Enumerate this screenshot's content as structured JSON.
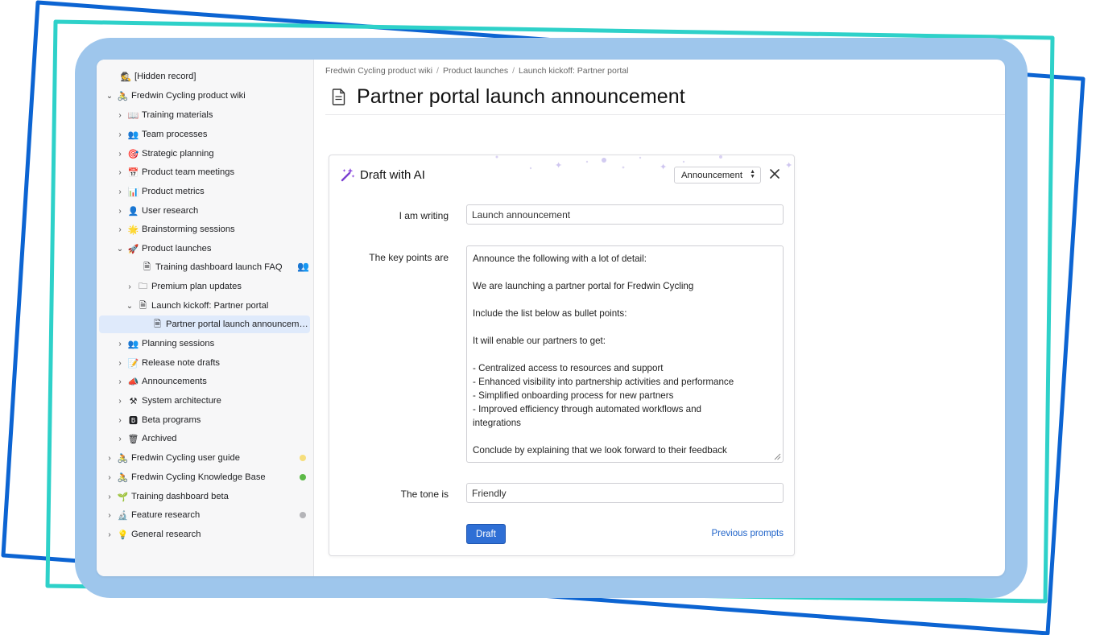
{
  "sidebar": {
    "items": [
      {
        "label": "[Hidden record]",
        "icon": "🕵",
        "chevron": "",
        "indent": 0
      },
      {
        "label": "Fredwin Cycling product wiki",
        "icon": "🚴",
        "chevron": "⌄",
        "indent": 0
      },
      {
        "label": "Training materials",
        "icon": "📖",
        "chevron": "›",
        "indent": 1
      },
      {
        "label": "Team processes",
        "icon": "👥",
        "chevron": "›",
        "indent": 1
      },
      {
        "label": "Strategic planning",
        "icon": "🎯",
        "chevron": "›",
        "indent": 1
      },
      {
        "label": "Product team meetings",
        "icon": "📅",
        "chevron": "›",
        "indent": 1
      },
      {
        "label": "Product metrics",
        "icon": "📊",
        "chevron": "›",
        "indent": 1
      },
      {
        "label": "User research",
        "icon": "👤",
        "chevron": "›",
        "indent": 1
      },
      {
        "label": "Brainstorming sessions",
        "icon": "🌟",
        "chevron": "›",
        "indent": 1
      },
      {
        "label": "Product launches",
        "icon": "🚀",
        "chevron": "⌄",
        "indent": 1
      },
      {
        "label": "Training dashboard launch FAQ",
        "icon": "🗎",
        "chevron": "",
        "indent": 2
      },
      {
        "label": "Premium plan updates",
        "icon": "🗀",
        "chevron": "›",
        "indent": 2
      },
      {
        "label": "Launch kickoff: Partner portal",
        "icon": "🗎",
        "chevron": "⌄",
        "indent": 2
      },
      {
        "label": "Partner portal launch announcement",
        "icon": "🗎",
        "chevron": "",
        "indent": 3
      },
      {
        "label": "Planning sessions",
        "icon": "👥",
        "chevron": "›",
        "indent": 1
      },
      {
        "label": "Release note drafts",
        "icon": "📝",
        "chevron": "›",
        "indent": 1
      },
      {
        "label": "Announcements",
        "icon": "📣",
        "chevron": "›",
        "indent": 1
      },
      {
        "label": "System architecture",
        "icon": "⚒",
        "chevron": "›",
        "indent": 1
      },
      {
        "label": "Beta programs",
        "icon": "🅱",
        "chevron": "›",
        "indent": 1
      },
      {
        "label": "Archived",
        "icon": "🗑",
        "chevron": "›",
        "indent": 1
      },
      {
        "label": "Fredwin Cycling user guide",
        "icon": "🚴",
        "chevron": "›",
        "indent": 0
      },
      {
        "label": "Fredwin Cycling Knowledge Base",
        "icon": "🚴",
        "chevron": "›",
        "indent": 0
      },
      {
        "label": "Training dashboard beta",
        "icon": "🌱",
        "chevron": "›",
        "indent": 0
      },
      {
        "label": "Feature research",
        "icon": "🔬",
        "chevron": "›",
        "indent": 0
      },
      {
        "label": "General research",
        "icon": "💡",
        "chevron": "›",
        "indent": 0
      }
    ],
    "status_colors": {
      "user_guide": "#f6de7c",
      "knowledge_base": "#5cb947",
      "feature_research": "#b4b4b8"
    }
  },
  "breadcrumb": [
    "Fredwin Cycling product wiki",
    "Product launches",
    "Launch kickoff: Partner portal"
  ],
  "page": {
    "title": "Partner portal launch announcement"
  },
  "ai": {
    "title": "Draft with AI",
    "type_select": "Announcement",
    "writing_label": "I am writing",
    "writing_value": "Launch announcement",
    "keypoints_label": "The key points are",
    "keypoints_lines": [
      "Announce the following with a lot of detail:",
      "",
      "We are launching a partner portal for Fredwin Cycling",
      "",
      "Include the list below as bullet points:",
      "",
      "It will enable our partners to get:",
      "",
      "- Centralized access to resources and support",
      "- Enhanced visibility into partnership activities and performance",
      "- Simplified onboarding process for new partners",
      "- Improved efficiency through automated workflows and",
      "integrations",
      "",
      "Conclude by explaining that we look forward to their feedback"
    ],
    "tone_label": "The tone is",
    "tone_value": "Friendly",
    "draft_button": "Draft",
    "previous_prompts": "Previous prompts"
  },
  "colors": {
    "accent": "#2f6fd5",
    "link": "#1f63c9",
    "selected_row": "#dfeafb",
    "frame_blue": "#0c64d2",
    "frame_teal": "#2ed1c9",
    "panel": "#9ec6ec"
  }
}
